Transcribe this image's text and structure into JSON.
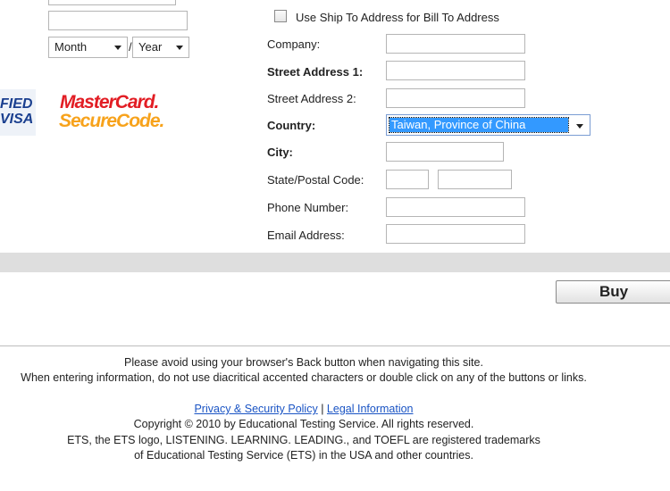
{
  "card": {
    "month_label": "Month",
    "separator": "/",
    "year_label": "Year"
  },
  "badges": {
    "visa_line1": "FIED",
    "visa_line2": "VISA",
    "mastercard_line1": "MasterCard.",
    "mastercard_line2": "SecureCode."
  },
  "shipping": {
    "use_ship_to_label": "Use Ship To Address for Bill To Address",
    "company_label": "Company:",
    "street1_label": "Street Address 1:",
    "street2_label": "Street Address 2:",
    "country_label": "Country:",
    "country_value": "Taiwan, Province of China",
    "city_label": "City:",
    "state_postal_label": "State/Postal Code:",
    "phone_label": "Phone Number:",
    "email_label": "Email Address:"
  },
  "actions": {
    "buy_label": "Buy"
  },
  "footer": {
    "notice1": "Please avoid using your browser's Back button when navigating this site.",
    "notice2": "When entering information, do not use diacritical accented characters or double click on any of the buttons or links.",
    "privacy_link": "Privacy & Security Policy",
    "link_separator": "|",
    "legal_link": "Legal Information",
    "copyright": "Copyright © 2010 by Educational Testing Service. All rights reserved.",
    "trademark1": "ETS, the ETS logo, LISTENING. LEARNING. LEADING., and TOEFL are registered trademarks",
    "trademark2": "of Educational Testing Service (ETS) in the USA and other countries."
  },
  "colors": {
    "link": "#1a54c4",
    "mastercard_red": "#e21d24",
    "mastercard_orange": "#f7a21b",
    "selection": "#3399ff",
    "band": "#dedede"
  }
}
